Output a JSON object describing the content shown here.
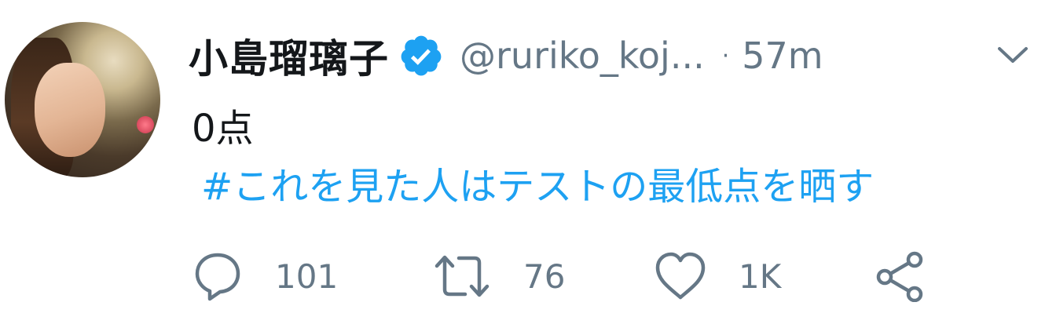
{
  "tweet": {
    "display_name": "小島瑠璃子",
    "handle": "@ruriko_koj...",
    "separator": "·",
    "time": "57m",
    "text": "0点",
    "hashtag": "#これを見た人はテストの最低点を晒す",
    "verified": true
  },
  "actions": {
    "replies": "101",
    "retweets": "76",
    "likes": "1K"
  },
  "colors": {
    "link": "#1da1f2",
    "secondary_text": "#657786",
    "primary_text": "#14171a"
  },
  "icons": [
    "verified-badge-icon",
    "chevron-down-icon",
    "reply-icon",
    "retweet-icon",
    "like-icon",
    "share-icon"
  ]
}
